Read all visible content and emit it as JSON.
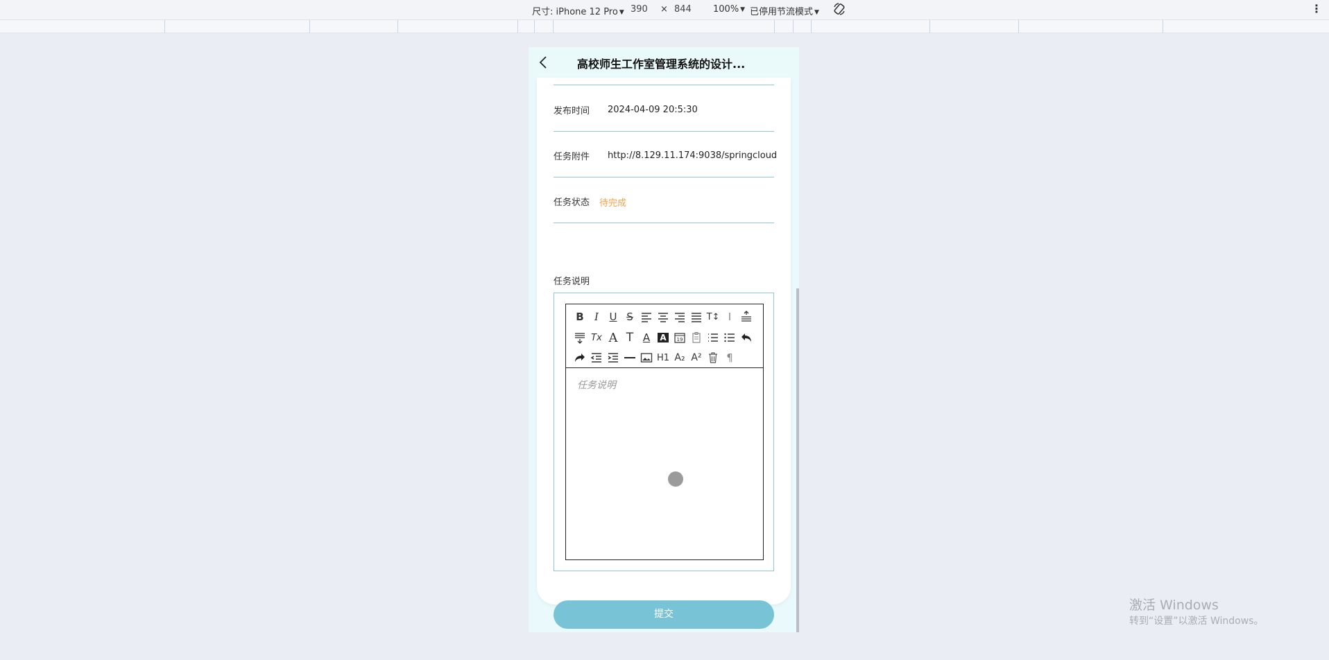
{
  "devtools": {
    "dimensions_label": "尺寸: iPhone 12 Pro",
    "width": "390",
    "times": "×",
    "height": "844",
    "zoom": "100%",
    "throttle": "已停用节流模式"
  },
  "app": {
    "nav_title": "高校师生工作室管理系统的设计...",
    "fields": [
      {
        "label": "发布时间",
        "value": "2024-04-09 20:5:30"
      },
      {
        "label": "任务附件",
        "value": "http://8.129.11.174:9038/springcloud"
      },
      {
        "label": "任务状态",
        "value": "待完成"
      }
    ],
    "description_label": "任务说明",
    "editor_placeholder": "任务说明",
    "submit_label": "提交",
    "toolbar": {
      "row1": [
        "B",
        "I",
        "U",
        "S",
        "≡",
        "≡",
        "≡",
        "≡",
        "T↕",
        "I",
        "≡"
      ],
      "row2": [
        "≡",
        "Tx",
        "A",
        "T",
        "A",
        "A",
        "19",
        "▤",
        "☰",
        "☰",
        "↶"
      ],
      "row3": [
        "↷",
        "⇤",
        "⇥",
        "—",
        "▭",
        "H1",
        "A₂",
        "A²",
        "🗑",
        "¶"
      ]
    }
  },
  "watermark": {
    "title": "激活 Windows",
    "subtitle": "转到“设置”以激活 Windows。"
  }
}
